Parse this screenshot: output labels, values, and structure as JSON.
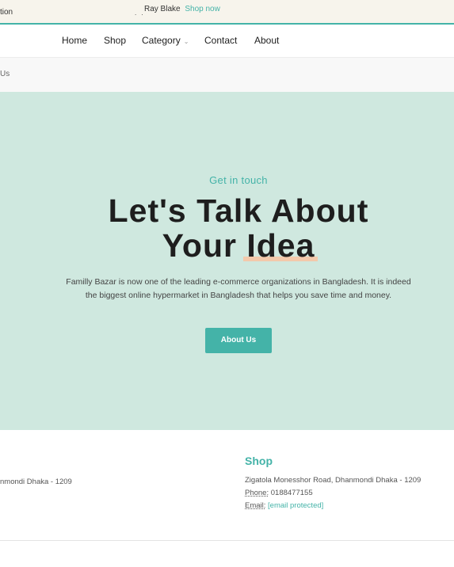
{
  "topbar": {
    "left_text": "tion",
    "marquee_name": "Ray Blake",
    "marquee_link": "Shop now",
    "dots": ". ."
  },
  "nav": {
    "items": [
      "Home",
      "Shop",
      "Category",
      "Contact",
      "About"
    ],
    "category_chevron": "⌄"
  },
  "breadcrumb": {
    "text": "Us"
  },
  "hero": {
    "eyebrow": "Get in touch",
    "title_line1": "Let's Talk About",
    "title_line2_pre": "Your ",
    "title_line2_hl": "Idea",
    "description": "Familly Bazar is now one of the leading e-commerce organizations in Bangladesh. It is indeed the biggest online hypermarket in Bangladesh that helps you save time and money.",
    "button_label": "About Us",
    "colors": {
      "background": "#cfe8df",
      "accent": "#44b3a8",
      "highlight": "#f3c9ab"
    }
  },
  "footer": {
    "left_address": "nmondi Dhaka - 1209",
    "shop": {
      "heading": "Shop",
      "address": "Zigatola Monesshor Road, Dhanmondi Dhaka - 1209",
      "phone_label": "Phone:",
      "phone_value": "0188477155",
      "email_label": "Email:",
      "email_value": "[email protected]"
    }
  }
}
